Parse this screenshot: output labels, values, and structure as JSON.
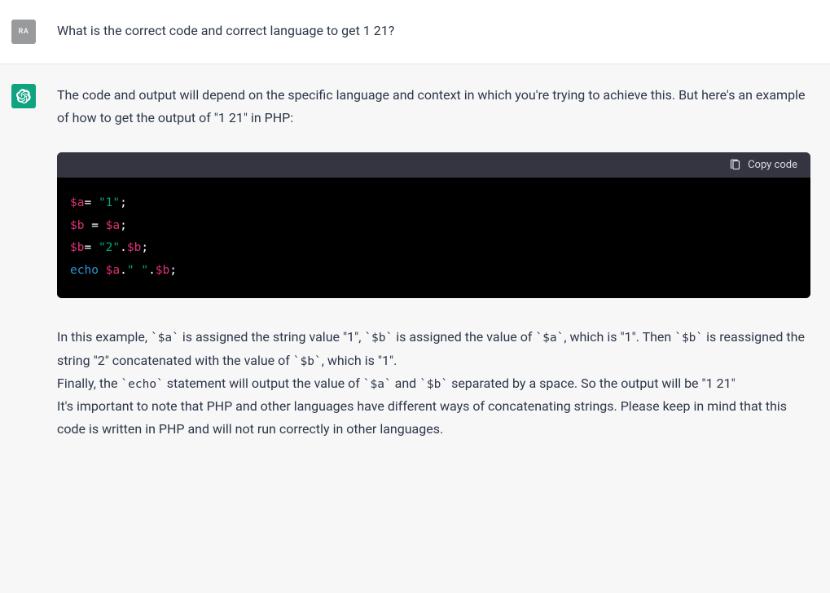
{
  "user": {
    "avatar_label": "RA",
    "question": "What is the correct code and correct language to get 1 21?"
  },
  "assistant": {
    "intro": "The code and output will depend on the specific language and context in which you're trying to achieve this. But here's an example of how to get the output of \"1 21\" in PHP:",
    "copy_label": "Copy code",
    "code": {
      "l1": {
        "v1": "$a",
        "op": "=",
        "s": "\"1\"",
        "end": ";"
      },
      "l2": {
        "v1": "$b",
        "op": "=",
        "v2": "$a",
        "end": ";"
      },
      "l3": {
        "v1": "$b",
        "op": "=",
        "s": "\"2\"",
        "dot": ".",
        "v2": "$b",
        "end": ";"
      },
      "l4": {
        "kw": "echo",
        "v1": "$a",
        "dot1": ".",
        "s": "\" \"",
        "dot2": ".",
        "v2": "$b",
        "end": ";"
      }
    },
    "p2_a": "In this example, ",
    "p2_code1": "`$a`",
    "p2_b": " is assigned the string value \"1\", ",
    "p2_code2": "`$b`",
    "p2_c": " is assigned the value of ",
    "p2_code3": "`$a`",
    "p2_d": ", which is \"1\". Then ",
    "p2_code4": "`$b`",
    "p2_e": " is reassigned the string \"2\" concatenated with the value of ",
    "p2_code5": "`$b`",
    "p2_f": ", which is \"1\".",
    "p3_a": "Finally, the ",
    "p3_code1": "`echo`",
    "p3_b": " statement will output the value of ",
    "p3_code2": "`$a`",
    "p3_c": " and ",
    "p3_code3": "`$b`",
    "p3_d": " separated by a space. So the output will be \"1 21\"",
    "p4": "It's important to note that PHP and other languages have different ways of concatenating strings. Please keep in mind that this code is written in PHP and will not run correctly in other languages."
  }
}
